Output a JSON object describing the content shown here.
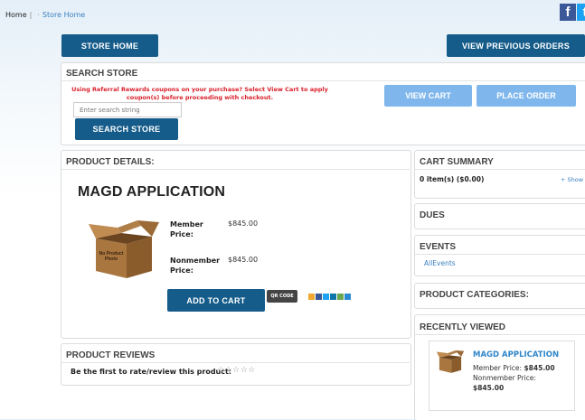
{
  "breadcrumb": {
    "home": "Home",
    "sep": "|",
    "store": "Store Home"
  },
  "social": {
    "facebook": "f",
    "twitter": "t"
  },
  "nav": {
    "store_home": "STORE HOME",
    "view_previous_orders": "VIEW PREVIOUS ORDERS"
  },
  "search": {
    "title": "SEARCH STORE",
    "notice_line1": "Using Referral Rewards coupons on your purchase? Select View Cart to apply",
    "notice_line2": "coupon(s) before proceeding with checkout.",
    "placeholder": "Enter search string",
    "button": "SEARCH STORE",
    "view_cart": "VIEW CART",
    "place_order": "PLACE ORDER"
  },
  "product": {
    "section_title": "PRODUCT DETAILS:",
    "name": "MAGD APPLICATION",
    "image_text": "No Product Photo",
    "member_label_1": "Member",
    "member_label_2": "Price:",
    "member_price": "$845.00",
    "nonmember_label_1": "Nonmember",
    "nonmember_label_2": "Price:",
    "nonmember_price": "$845.00",
    "add_to_cart": "ADD TO CART",
    "badge_text": "QR CODE"
  },
  "reviews": {
    "title": "PRODUCT REVIEWS",
    "prompt": "Be the first to rate/review this product:",
    "stars": "☆☆☆☆☆"
  },
  "sidebar": {
    "cart_title": "CART SUMMARY",
    "cart_items": "0 item(s) ($0.00)",
    "cart_show": "+ Show",
    "dues_title": "DUES",
    "events_title": "EVENTS",
    "events_link": "AllEvents",
    "categories_title": "PRODUCT CATEGORIES:",
    "recent_title": "RECENTLY VIEWED",
    "recent_item": {
      "name": "MAGD APPLICATION",
      "member_label": "Member Price:",
      "member_price": "$845.00",
      "nonmember_label": "Nonmember Price:",
      "nonmember_price": "$845.00"
    }
  },
  "colors": {
    "primary": "#155c8a",
    "light_button": "#7fb7ec",
    "notice": "#d9202b",
    "link": "#3a7fbf"
  }
}
